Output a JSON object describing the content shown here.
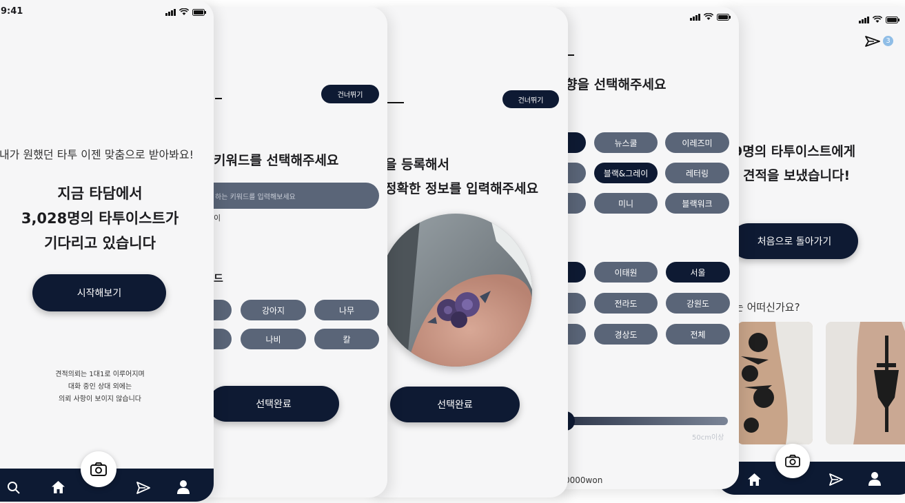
{
  "status": {
    "time": "9:41"
  },
  "screen1": {
    "tagline": "내가 원했던 타투 이젠 맞춤으로 받아봐요!",
    "headline": [
      "지금 타담에서",
      "3,028명의 타투이스트가",
      "기다리고 있습니다"
    ],
    "start_button": "시작해보기",
    "notice": [
      "견적의뢰는 1대1로 이루어지며",
      "대화 중인 상대 외에는",
      "의뢰 사항이 보이지 않습니다"
    ]
  },
  "screen2": {
    "skip": "건너뛰기",
    "title": "키워드를 선택해주세요",
    "search_placeholder": "하는 키워드를 입력해보세요",
    "sub_text": "이",
    "section_label": "드",
    "chips": [
      "강아지",
      "나무",
      "나비",
      "칼"
    ],
    "done_button": "선택완료"
  },
  "screen3": {
    "skip": "건너뛰기",
    "title_line1": "을 등록해서",
    "title_line2": "정확한 정보를 입력해주세요",
    "done_button": "선택완료"
  },
  "screen4": {
    "title": "향을 선택해주세요",
    "style_chips": [
      "뉴스쿨",
      "이레즈미",
      "블랙&그레이",
      "레터링",
      "미니",
      "블랙워크"
    ],
    "region_chips": [
      "이태원",
      "서울",
      "전라도",
      "강원도",
      "경상도",
      "전체"
    ],
    "slider_max": "50cm이상",
    "price_text": "0000won"
  },
  "screen5": {
    "badge": "3",
    "result_line1": "9명의 타투이스트에게",
    "result_line2": "견적을 보냈습니다!",
    "back_button": "처음으로 돌아가기",
    "question": "는 어떠신가요?"
  },
  "colors": {
    "navy": "#0e1a33",
    "chip_gray": "#5a6578",
    "background": "#f6f6f7"
  }
}
